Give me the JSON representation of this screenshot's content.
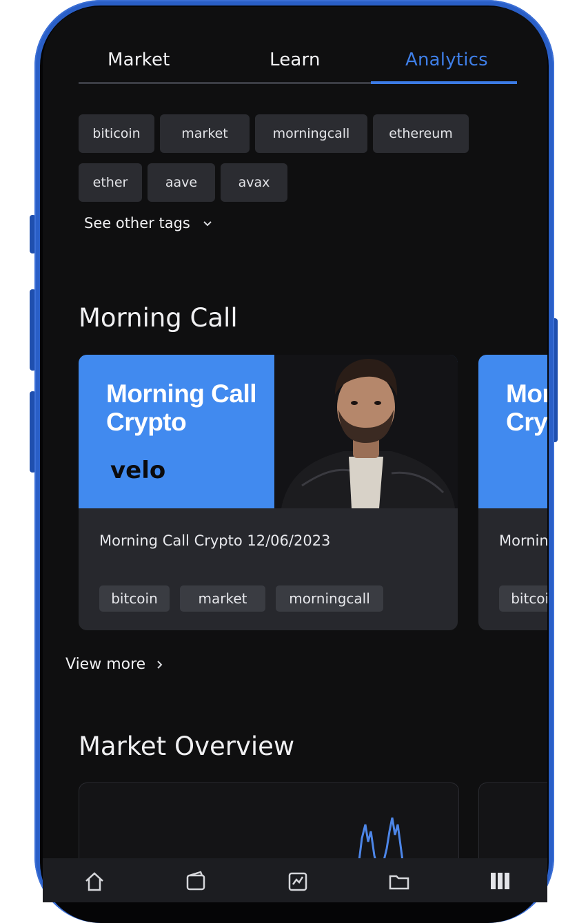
{
  "tabs": [
    {
      "label": "Market",
      "active": false
    },
    {
      "label": "Learn",
      "active": false
    },
    {
      "label": "Analytics",
      "active": true
    }
  ],
  "tags": [
    "biticoin",
    "market",
    "morningcall",
    "ethereum",
    "ether",
    "aave",
    "avax"
  ],
  "see_other_tags": "See other tags",
  "morning_call": {
    "section_title": "Morning Call",
    "cards": [
      {
        "thumb_title": "Morning Call Crypto",
        "thumb_brand": "velo",
        "title": "Morning Call Crypto 12/06/2023",
        "tags": [
          "bitcoin",
          "market",
          "morningcall"
        ]
      },
      {
        "thumb_title": "Morning Call Crypto",
        "title": "Morning Call Crypto",
        "tags": [
          "bitcoin"
        ]
      }
    ],
    "view_more": "View more"
  },
  "market_overview": {
    "section_title": "Market Overview"
  },
  "bottom_nav": [
    "home-icon",
    "wallet-icon",
    "chart-icon",
    "folder-icon",
    "grid-icon"
  ],
  "colors": {
    "accent": "#3c7be6",
    "thumb_blue": "#418aef",
    "frame_blue": "#2a5fc7",
    "screen_bg": "#0f0f10"
  }
}
